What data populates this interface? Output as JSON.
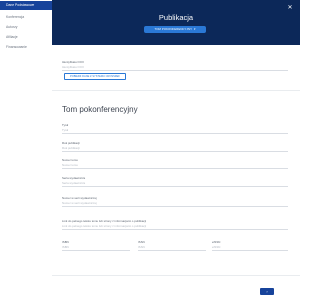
{
  "sidebar": {
    "items": [
      {
        "label": "Dane Podstawowe"
      },
      {
        "label": "Konferencja"
      },
      {
        "label": "Autorzy"
      },
      {
        "label": "Afiliacje"
      },
      {
        "label": "Finansowanie"
      }
    ]
  },
  "header": {
    "title": "Publikacja",
    "button_label": "TOM POKONFERENCYJNY"
  },
  "form": {
    "identifier": {
      "label": "Identyfikator DOI",
      "placeholder": "Identyfikator DOI"
    },
    "fetch_button": "POBIERZ DANE Z SYSTEMU CROSSREF",
    "section_title": "Tom pokonferencyjny",
    "fields": [
      {
        "label": "Tytuł",
        "placeholder": "Tytuł"
      },
      {
        "label": "Rok publikacji",
        "placeholder": "Rok publikacji"
      },
      {
        "label": "Numer tomu",
        "placeholder": "Numer tomu"
      },
      {
        "label": "Seria wydawnicza",
        "placeholder": "Seria wydawnicza"
      },
      {
        "label": "Numer w serii wydawniczej",
        "placeholder": "Numer w serii wydawniczej"
      },
      {
        "label": "Link do pełnego tekstu tomu lub strony z informacjami o publikacji",
        "placeholder": "Link do pełnego tekstu tomu lub strony z informacjami o publikacji"
      }
    ],
    "isbn": {
      "label": "ISBN",
      "placeholder": "ISBN"
    },
    "issn": {
      "label": "ISSN",
      "placeholder": "ISSN"
    },
    "eissn": {
      "label": "eISSN",
      "placeholder": "eISSN"
    }
  },
  "footer": {
    "next_label": "›"
  }
}
